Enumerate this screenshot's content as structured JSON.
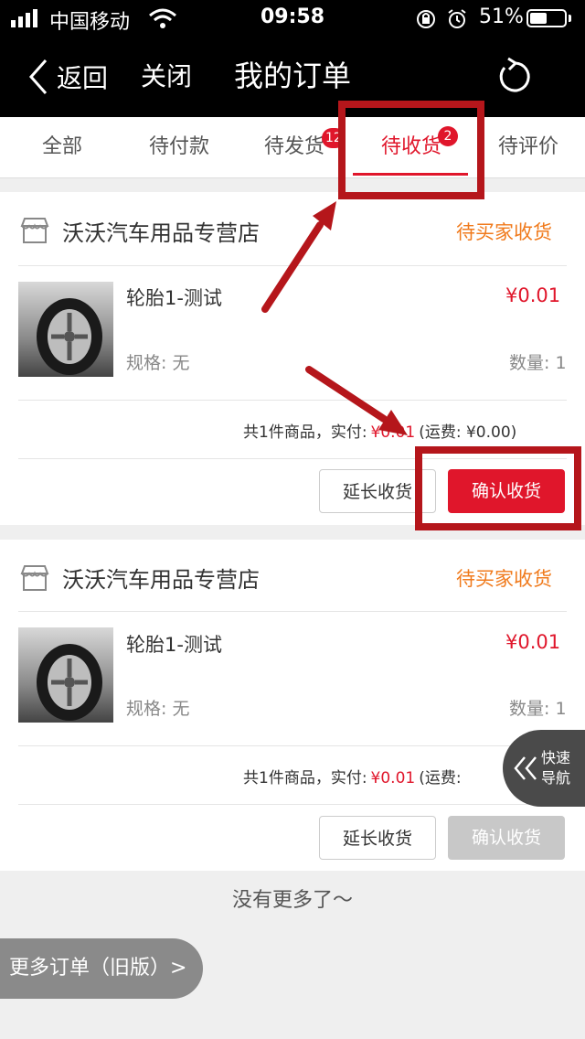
{
  "status_bar": {
    "carrier": "中国移动",
    "time": "09:58",
    "battery": "51%",
    "battery_level": 0.51
  },
  "nav": {
    "back_label": "返回",
    "close_label": "关闭",
    "title": "我的订单"
  },
  "tabs": [
    {
      "label": "全部"
    },
    {
      "label": "待付款"
    },
    {
      "label": "待发货",
      "badge": "12"
    },
    {
      "label": "待收货",
      "badge": "2",
      "active": true
    },
    {
      "label": "待评价"
    }
  ],
  "orders": [
    {
      "store": "沃沃汽车用品专营店",
      "status": "待买家收货",
      "product_name": "轮胎1-测试",
      "price": "¥0.01",
      "spec": "规格: 无",
      "qty": "数量: 1",
      "summary_prefix": "共1件商品，实付:",
      "summary_amount": "¥0.01",
      "summary_suffix": "(运费: ¥0.00)",
      "extend_label": "延长收货",
      "confirm_label": "确认收货"
    },
    {
      "store": "沃沃汽车用品专营店",
      "status": "待买家收货",
      "product_name": "轮胎1-测试",
      "price": "¥0.01",
      "spec": "规格: 无",
      "qty": "数量: 1",
      "summary_prefix": "共1件商品，实付:",
      "summary_amount": "¥0.01",
      "summary_suffix": "(运费:",
      "extend_label": "延长收货",
      "confirm_label": "确认收货"
    }
  ],
  "no_more_text": "没有更多了～",
  "old_orders_label": "更多订单（旧版）>",
  "quick_nav_label_1": "快速",
  "quick_nav_label_2": "导航",
  "colors": {
    "accent": "#e0162b",
    "status_orange": "#f07a1c",
    "annotation": "#b5161b"
  },
  "icons": [
    "signal-icon",
    "wifi-icon",
    "lock-rotation-icon",
    "alarm-icon",
    "battery-icon",
    "back-chevron-icon",
    "refresh-icon",
    "store-icon",
    "tire-image",
    "double-chevron-left-icon"
  ]
}
